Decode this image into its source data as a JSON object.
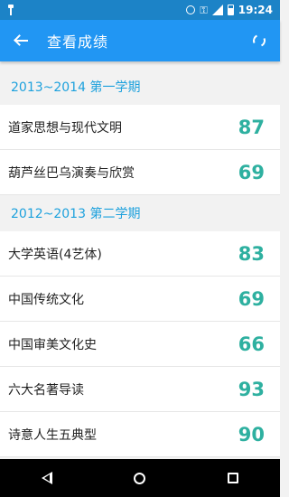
{
  "status_bar": {
    "time": "19:24"
  },
  "app_bar": {
    "title": "查看成绩"
  },
  "semesters": [
    {
      "title": "2013~2014 第一学期",
      "courses": [
        {
          "name": "道家思想与现代文明",
          "score": "87"
        },
        {
          "name": "葫芦丝巴乌演奏与欣赏",
          "score": "69"
        }
      ]
    },
    {
      "title": "2012~2013 第二学期",
      "courses": [
        {
          "name": "大学英语(4艺体)",
          "score": "83"
        },
        {
          "name": "中国传统文化",
          "score": "69"
        },
        {
          "name": "中国审美文化史",
          "score": "66"
        },
        {
          "name": "六大名著导读",
          "score": "93"
        },
        {
          "name": "诗意人生五典型",
          "score": "90"
        }
      ]
    }
  ],
  "colors": {
    "status_bar": "#1c83c7",
    "app_bar": "#2196f3",
    "semester_text": "#1da1dd",
    "score": "#2eb0a0"
  },
  "icons": [
    "usb-icon",
    "alarm-icon",
    "key-icon",
    "signal-icon",
    "battery-icon",
    "back-arrow-icon",
    "refresh-icon",
    "nav-back-icon",
    "nav-home-icon",
    "nav-recent-icon"
  ]
}
